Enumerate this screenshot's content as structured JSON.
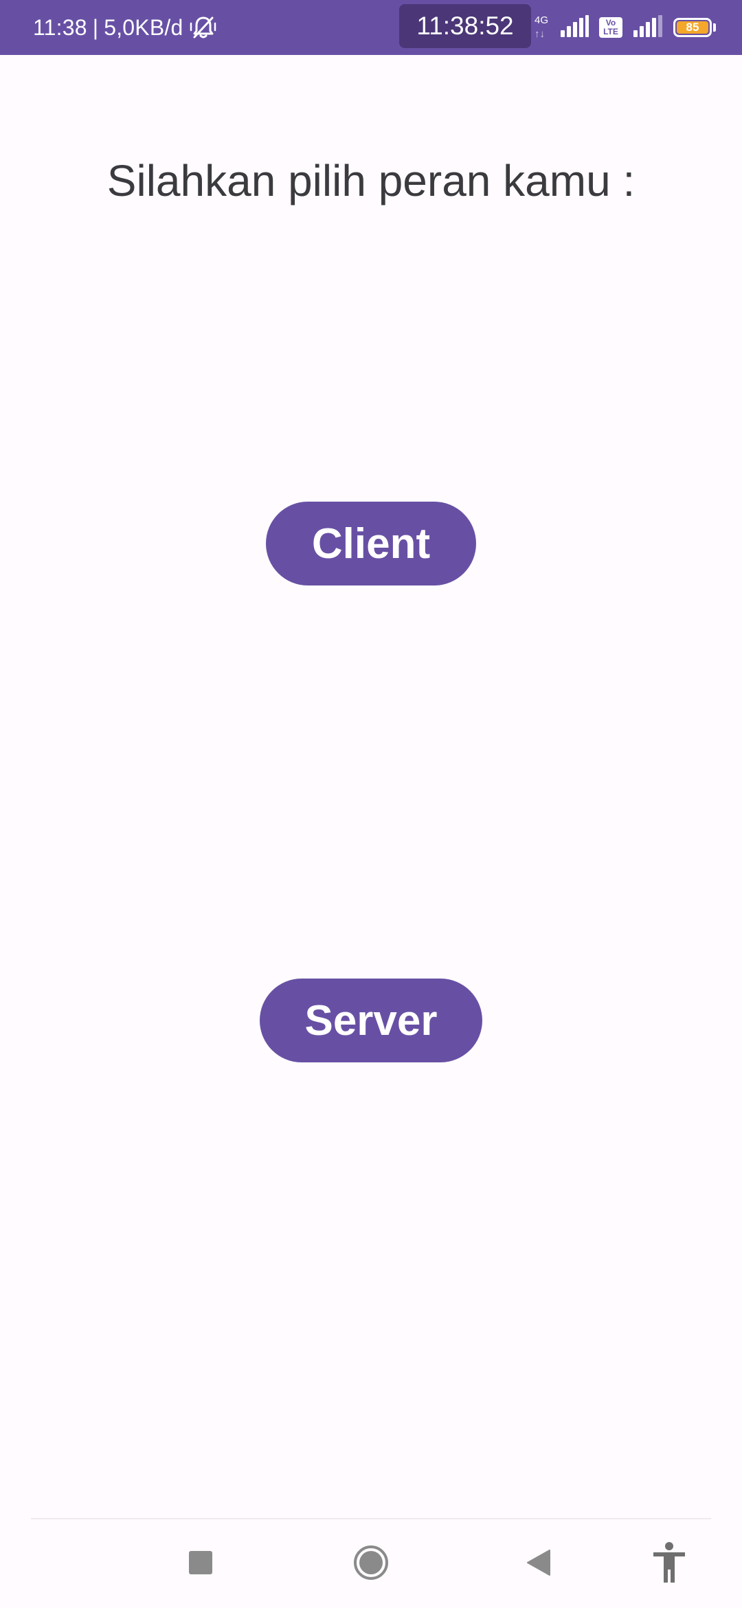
{
  "status_bar": {
    "time": "11:38",
    "separator": "|",
    "data_speed": "5,0KB/d",
    "clock_overlay": "11:38:52",
    "network_type": "4G",
    "network_arrows": "↑↓",
    "volte_label": "Vo LTE",
    "battery_level": "85",
    "colors": {
      "background": "#6750A4",
      "clock_pill": "#4B3777",
      "battery_fill": "#F4A72A"
    }
  },
  "main": {
    "prompt": "Silahkan pilih peran kamu :",
    "client_button_label": "Client",
    "server_button_label": "Server",
    "colors": {
      "background": "#FFFBFE",
      "button": "#6750A4",
      "text": "#3B3B3F"
    }
  },
  "nav_bar": {
    "icons": [
      "recents-icon",
      "home-icon",
      "back-icon",
      "accessibility-icon"
    ]
  }
}
